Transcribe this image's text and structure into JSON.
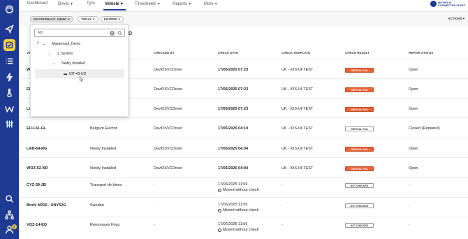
{
  "nav": {
    "items": [
      {
        "label": "Dashboard",
        "has_menu": false
      },
      {
        "label": "Driver",
        "has_menu": true
      },
      {
        "label": "Tyre",
        "has_menu": false
      },
      {
        "label": "Vehicle",
        "has_menu": true
      },
      {
        "label": "Timesheets",
        "has_menu": true
      },
      {
        "label": "Reports",
        "has_menu": true
      },
      {
        "label": "More",
        "has_menu": true
      }
    ],
    "active": "Vehicle",
    "logo_line1": "MICHELIN",
    "logo_line2": "CONNECTED FLEET"
  },
  "filters": {
    "group": "MASTERNAUT_DEMO",
    "period": "TODAY",
    "filters_label": "FILTERS",
    "actions_label": "ACTIONS",
    "peek_char": "D"
  },
  "dropdown": {
    "search_value": "lot",
    "clear_glyph": "×",
    "check_glyph": "✓",
    "tree": [
      {
        "label": "Masternaut_Demo",
        "level": 0,
        "expanded": true,
        "checked": true
      },
      {
        "label": "z_System",
        "level": 1,
        "expanded": true
      },
      {
        "label": "Newly Installed",
        "level": 2,
        "expanded": true
      },
      {
        "label": "IOT-43-UO",
        "level": 3,
        "vehicle": true
      }
    ]
  },
  "table": {
    "columns": [
      "VE",
      "CHECKED BY",
      "CHECK DATE",
      "CHECK TEMPLATE",
      "CHECK RESULT",
      "REPAIR STATUS"
    ],
    "rows": [
      {
        "vehicle": "W",
        "group": "",
        "checked_by": "DeviOSVCDriver",
        "date": "17/06/2025 07:23",
        "template": "UK - IOS-UI-TEST",
        "result": "CRITICAL FAIL",
        "result_type": "fail",
        "repair": "Open"
      },
      {
        "vehicle": "El",
        "group": "",
        "checked_by": "DeviOSVCDriver",
        "date": "17/06/2025 07:23",
        "template": "UK - IOS-UI-TEST",
        "result": "CRITICAL FAIL",
        "result_type": "fail",
        "repair": "Open"
      },
      {
        "vehicle": "LA",
        "group": "",
        "checked_by": "DeviOSVCDriver",
        "date": "17/06/2025 07:23",
        "template": "UK - IOS-UI-TEST",
        "result": "CRITICAL FAIL",
        "result_type": "fail",
        "repair": "Open"
      },
      {
        "vehicle": "ELU-61-GL",
        "group": "Belgium Electric",
        "checked_by": "DeviOSVCDriver",
        "date": "17/06/2025 04:10",
        "template": "UK - IOS-UI-TEST",
        "result": "CRITICAL FAIL",
        "result_type": "nc",
        "repair": "Closed (Repaired)"
      },
      {
        "vehicle": "LAB-64-RG",
        "group": "Newly Installed",
        "checked_by": "DeviOSVCDriver",
        "date": "17/06/2025 04:04",
        "template": "UK - IOS-UI-TEST",
        "result": "CRITICAL FAIL",
        "result_type": "fail",
        "repair": "Open"
      },
      {
        "vehicle": "WOZ-52-NR",
        "group": "Newly Installed",
        "checked_by": "DeviOSVCDriver",
        "date": "17/06/2025 04:04",
        "template": "UK - IOS-UI-TEST",
        "result": "CRITICAL FAIL",
        "result_type": "fail",
        "repair": "Open"
      },
      {
        "vehicle": "CYZ-39-JB",
        "group": "Transport de biens",
        "checked_by": "-",
        "date": "17/06/2025 11:56",
        "moved": "Moved without check",
        "template": "-",
        "result": "NOT CHECKED",
        "result_type": "nc",
        "repair": "-"
      },
      {
        "vehicle": "Brohl M210 - UNY62G",
        "group": "Sweden",
        "checked_by": "-",
        "date": "17/06/2025 11:56",
        "moved": "Moved without check",
        "template": "-",
        "result": "NOT CHECKED",
        "result_type": "nc",
        "repair": "-"
      },
      {
        "vehicle": "VQZ-14-EQ",
        "group": "Remorques Frigo",
        "checked_by": "-",
        "date": "17/06/2025 11:56",
        "moved": "Moved without check",
        "template": "-",
        "result": "NOT CHECKED",
        "result_type": "nc",
        "repair": "-"
      }
    ]
  },
  "sidebar": {
    "icons": [
      "logo-swirl-icon",
      "navigate-icon",
      "vehicle-check-icon",
      "list-icon",
      "lightning-icon",
      "thermometer-icon",
      "w-icon",
      "sliders-icon",
      "search-icon",
      "hierarchy-icon",
      "user-icon"
    ],
    "active_index": 2,
    "badge": "2"
  },
  "colors": {
    "sidebar": "#1f3a93",
    "accent": "#f4d03f",
    "fail": "#e8633a"
  }
}
